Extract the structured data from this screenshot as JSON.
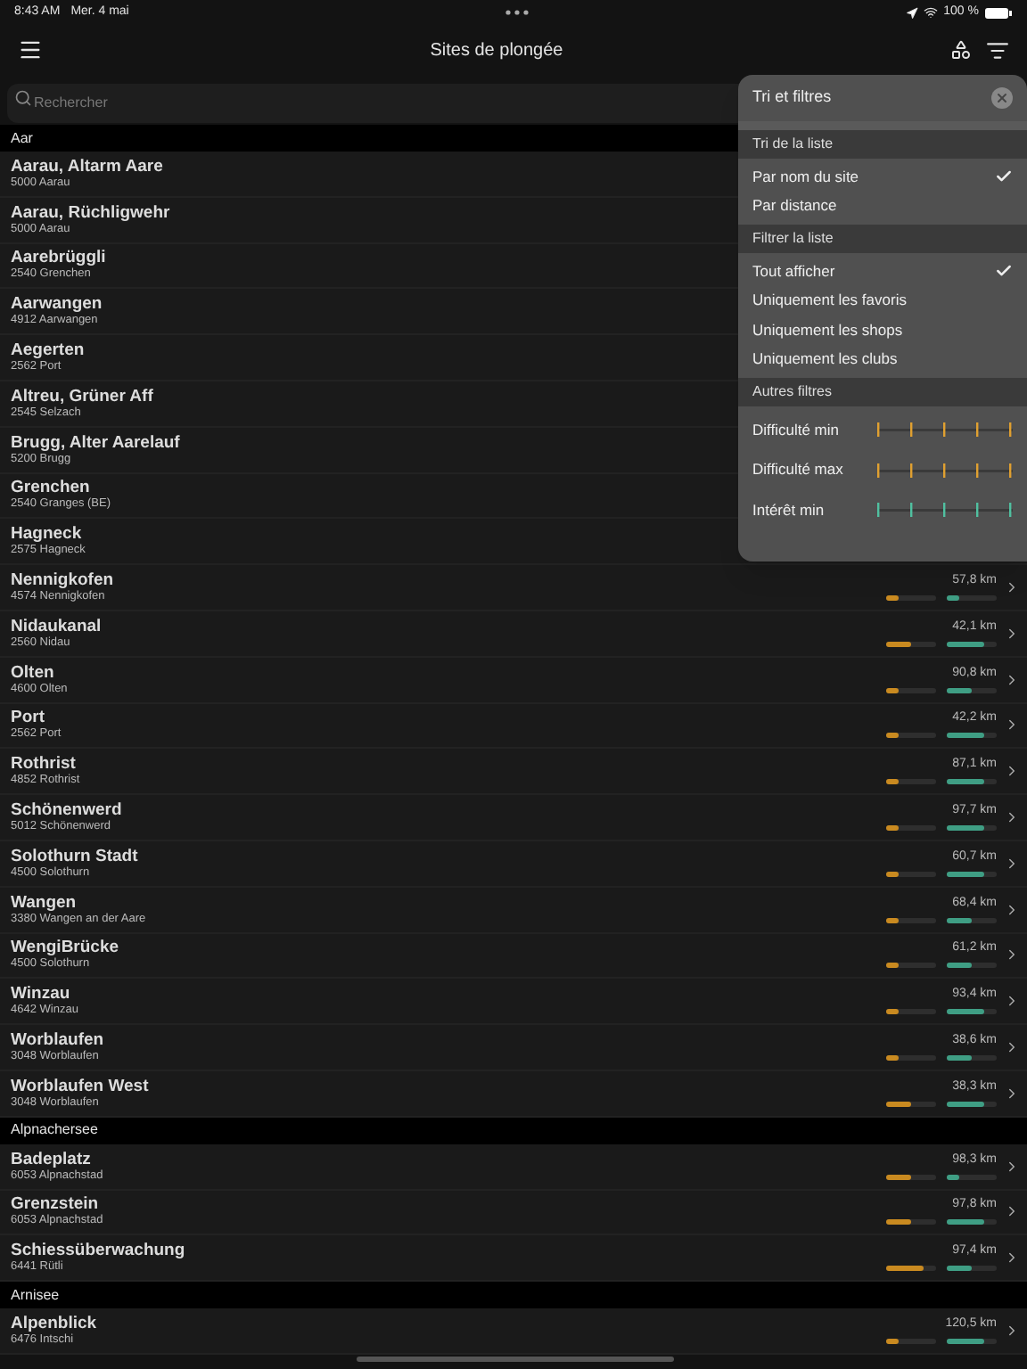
{
  "status_bar": {
    "time": "8:43 AM",
    "date": "Mer. 4 mai",
    "battery": "100 %"
  },
  "nav": {
    "title": "Sites de plongée"
  },
  "search": {
    "placeholder": "Rechercher"
  },
  "sections": [
    {
      "title": "Aar",
      "rows": [
        {
          "name": "Aarau, Altarm Aare",
          "place": "5000 Aarau"
        },
        {
          "name": "Aarau, Rüchligwehr",
          "place": "5000 Aarau"
        },
        {
          "name": "Aarebrüggli",
          "place": "2540 Grenchen"
        },
        {
          "name": "Aarwangen",
          "place": "4912 Aarwangen"
        },
        {
          "name": "Aegerten",
          "place": "2562 Port"
        },
        {
          "name": "Altreu, Grüner Aff",
          "place": "2545 Selzach"
        },
        {
          "name": "Brugg, Alter Aarelauf",
          "place": "5200 Brugg"
        },
        {
          "name": "Grenchen",
          "place": "2540 Granges (BE)"
        },
        {
          "name": "Hagneck",
          "place": "2575 Hagneck"
        },
        {
          "name": "Nennigkofen",
          "place": "4574 Nennigkofen",
          "distance": "57,8 km",
          "difficulty": {
            "level": 0.25
          },
          "interest": {
            "level": 0.25
          }
        },
        {
          "name": "Nidaukanal",
          "place": "2560 Nidau",
          "distance": "42,1 km",
          "difficulty": {
            "level": 0.5
          },
          "interest": {
            "level": 0.75
          }
        },
        {
          "name": "Olten",
          "place": "4600 Olten",
          "distance": "90,8 km",
          "difficulty": {
            "level": 0.25
          },
          "interest": {
            "level": 0.5
          }
        },
        {
          "name": "Port",
          "place": "2562 Port",
          "distance": "42,2 km",
          "difficulty": {
            "level": 0.25
          },
          "interest": {
            "level": 0.75
          }
        },
        {
          "name": "Rothrist",
          "place": "4852 Rothrist",
          "distance": "87,1 km",
          "difficulty": {
            "level": 0.25
          },
          "interest": {
            "level": 0.75
          }
        },
        {
          "name": "Schönenwerd",
          "place": "5012 Schönenwerd",
          "distance": "97,7 km",
          "difficulty": {
            "level": 0.25
          },
          "interest": {
            "level": 0.75
          }
        },
        {
          "name": "Solothurn Stadt",
          "place": "4500 Solothurn",
          "distance": "60,7 km",
          "difficulty": {
            "level": 0.25
          },
          "interest": {
            "level": 0.75
          }
        },
        {
          "name": "Wangen",
          "place": "3380 Wangen an der Aare",
          "distance": "68,4 km",
          "difficulty": {
            "level": 0.25
          },
          "interest": {
            "level": 0.5
          }
        },
        {
          "name": "WengiBrücke",
          "place": "4500 Solothurn",
          "distance": "61,2 km",
          "difficulty": {
            "level": 0.25
          },
          "interest": {
            "level": 0.5
          }
        },
        {
          "name": "Winzau",
          "place": "4642 Winzau",
          "distance": "93,4 km",
          "difficulty": {
            "level": 0.25
          },
          "interest": {
            "level": 0.75
          }
        },
        {
          "name": "Worblaufen",
          "place": "3048 Worblaufen",
          "distance": "38,6 km",
          "difficulty": {
            "level": 0.25
          },
          "interest": {
            "level": 0.5
          }
        },
        {
          "name": "Worblaufen West",
          "place": "3048 Worblaufen",
          "distance": "38,3 km",
          "difficulty": {
            "level": 0.5
          },
          "interest": {
            "level": 0.75
          }
        }
      ]
    },
    {
      "title": "Alpnachersee",
      "rows": [
        {
          "name": "Badeplatz",
          "place": "6053 Alpnachstad",
          "distance": "98,3 km",
          "difficulty": {
            "level": 0.5
          },
          "interest": {
            "level": 0.25
          }
        },
        {
          "name": "Grenzstein",
          "place": "6053 Alpnachstad",
          "distance": "97,8 km",
          "difficulty": {
            "level": 0.5
          },
          "interest": {
            "level": 0.75
          }
        },
        {
          "name": "Schiessüberwachung",
          "place": "6441 Rütli",
          "distance": "97,4 km",
          "difficulty": {
            "level": 0.75
          },
          "interest": {
            "level": 0.5
          }
        }
      ]
    },
    {
      "title": "Arnisee",
      "rows": [
        {
          "name": "Alpenblick",
          "place": "6476 Intschi",
          "distance": "120,5 km",
          "difficulty": {
            "level": 0.25
          },
          "interest": {
            "level": 0.75
          }
        }
      ]
    }
  ],
  "popover": {
    "title": "Tri et filtres",
    "groups": [
      {
        "title": "Tri de la liste",
        "options": [
          {
            "label": "Par nom du site",
            "selected": true
          },
          {
            "label": "Par distance",
            "selected": false
          }
        ]
      },
      {
        "title": "Filtrer la liste",
        "options": [
          {
            "label": "Tout afficher",
            "selected": true
          },
          {
            "label": "Uniquement les favoris",
            "selected": false
          },
          {
            "label": "Uniquement les shops",
            "selected": false
          },
          {
            "label": "Uniquement les clubs",
            "selected": false
          }
        ]
      },
      {
        "title": "Autres filtres",
        "sliders": [
          {
            "label": "Difficulté min",
            "color": "#e0a030"
          },
          {
            "label": "Difficulté max",
            "color": "#e0a030"
          },
          {
            "label": "Intérêt min",
            "color": "#50c0a0"
          }
        ]
      }
    ]
  }
}
